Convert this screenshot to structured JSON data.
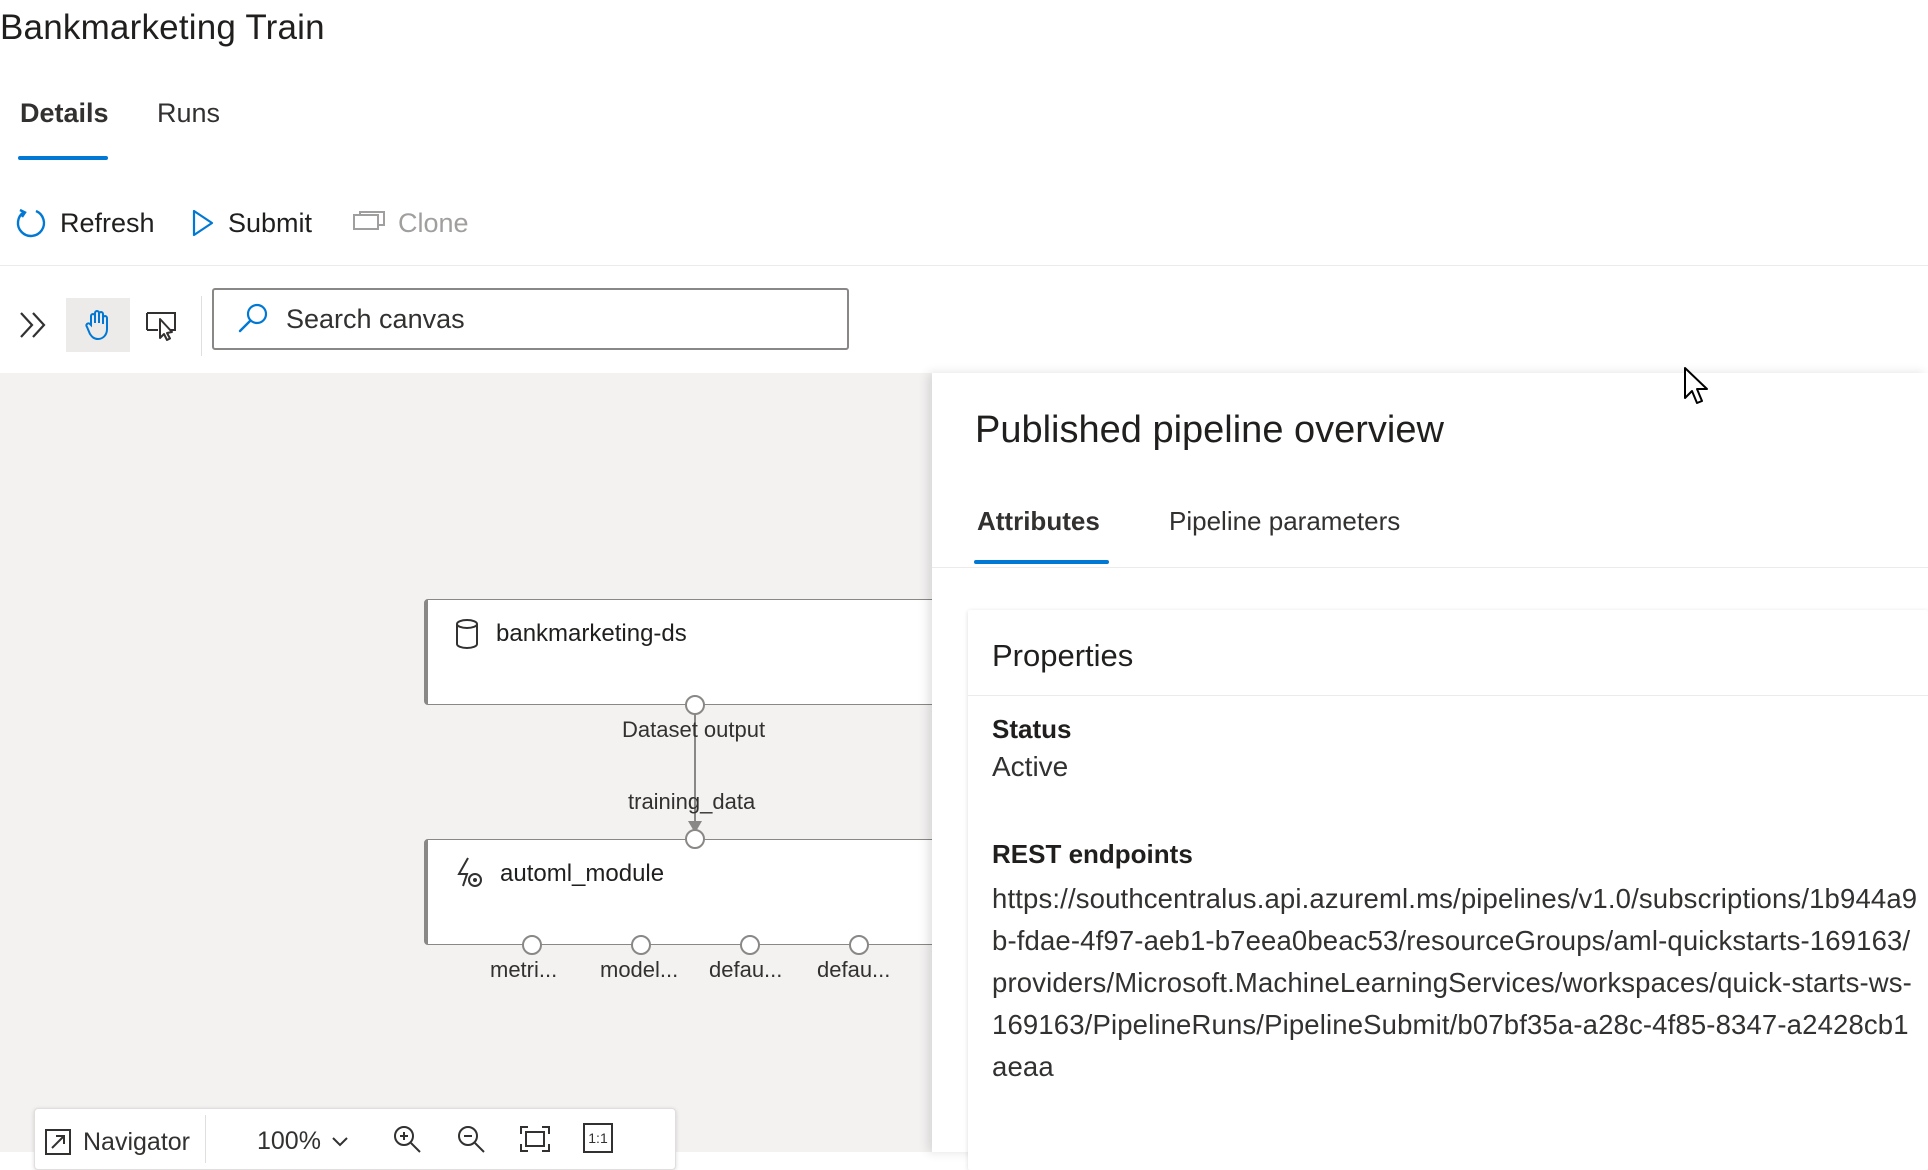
{
  "page": {
    "title": "Bankmarketing Train",
    "tabs": [
      {
        "label": "Details",
        "active": true
      },
      {
        "label": "Runs",
        "active": false
      }
    ]
  },
  "commands": {
    "refresh": "Refresh",
    "submit": "Submit",
    "clone": "Clone"
  },
  "toolbar": {
    "search_placeholder": "Search canvas",
    "search_value": ""
  },
  "canvas": {
    "nodes": {
      "dataset": {
        "label": "bankmarketing-ds",
        "icon": "database-icon",
        "output_port": "Dataset output"
      },
      "automl": {
        "label": "automl_module",
        "icon": "automl-icon",
        "input_port": "training_data",
        "output_ports": [
          "metri...",
          "model...",
          "defau...",
          "defau..."
        ]
      }
    },
    "navigator": {
      "label": "Navigator",
      "zoom": "100%",
      "actual_size": "1:1"
    }
  },
  "panel": {
    "title": "Published pipeline overview",
    "tabs": [
      {
        "label": "Attributes",
        "active": true
      },
      {
        "label": "Pipeline parameters",
        "active": false
      }
    ],
    "properties": {
      "heading": "Properties",
      "status_label": "Status",
      "status_value": "Active",
      "rest_label": "REST endpoints",
      "rest_value": "https://southcentralus.api.azureml.ms/pipelines/v1.0/subscriptions/1b944a9b-fdae-4f97-aeb1-b7eea0beac53/resourceGroups/aml-quickstarts-169163/providers/Microsoft.MachineLearningServices/workspaces/quick-starts-ws-169163/PipelineRuns/PipelineSubmit/b07bf35a-a28c-4f85-8347-a2428cb1aeaa"
    }
  },
  "colors": {
    "accent": "#0078d4",
    "canvas_bg": "#f3f2f1",
    "text": "#201f1e",
    "disabled": "#a19f9d"
  }
}
